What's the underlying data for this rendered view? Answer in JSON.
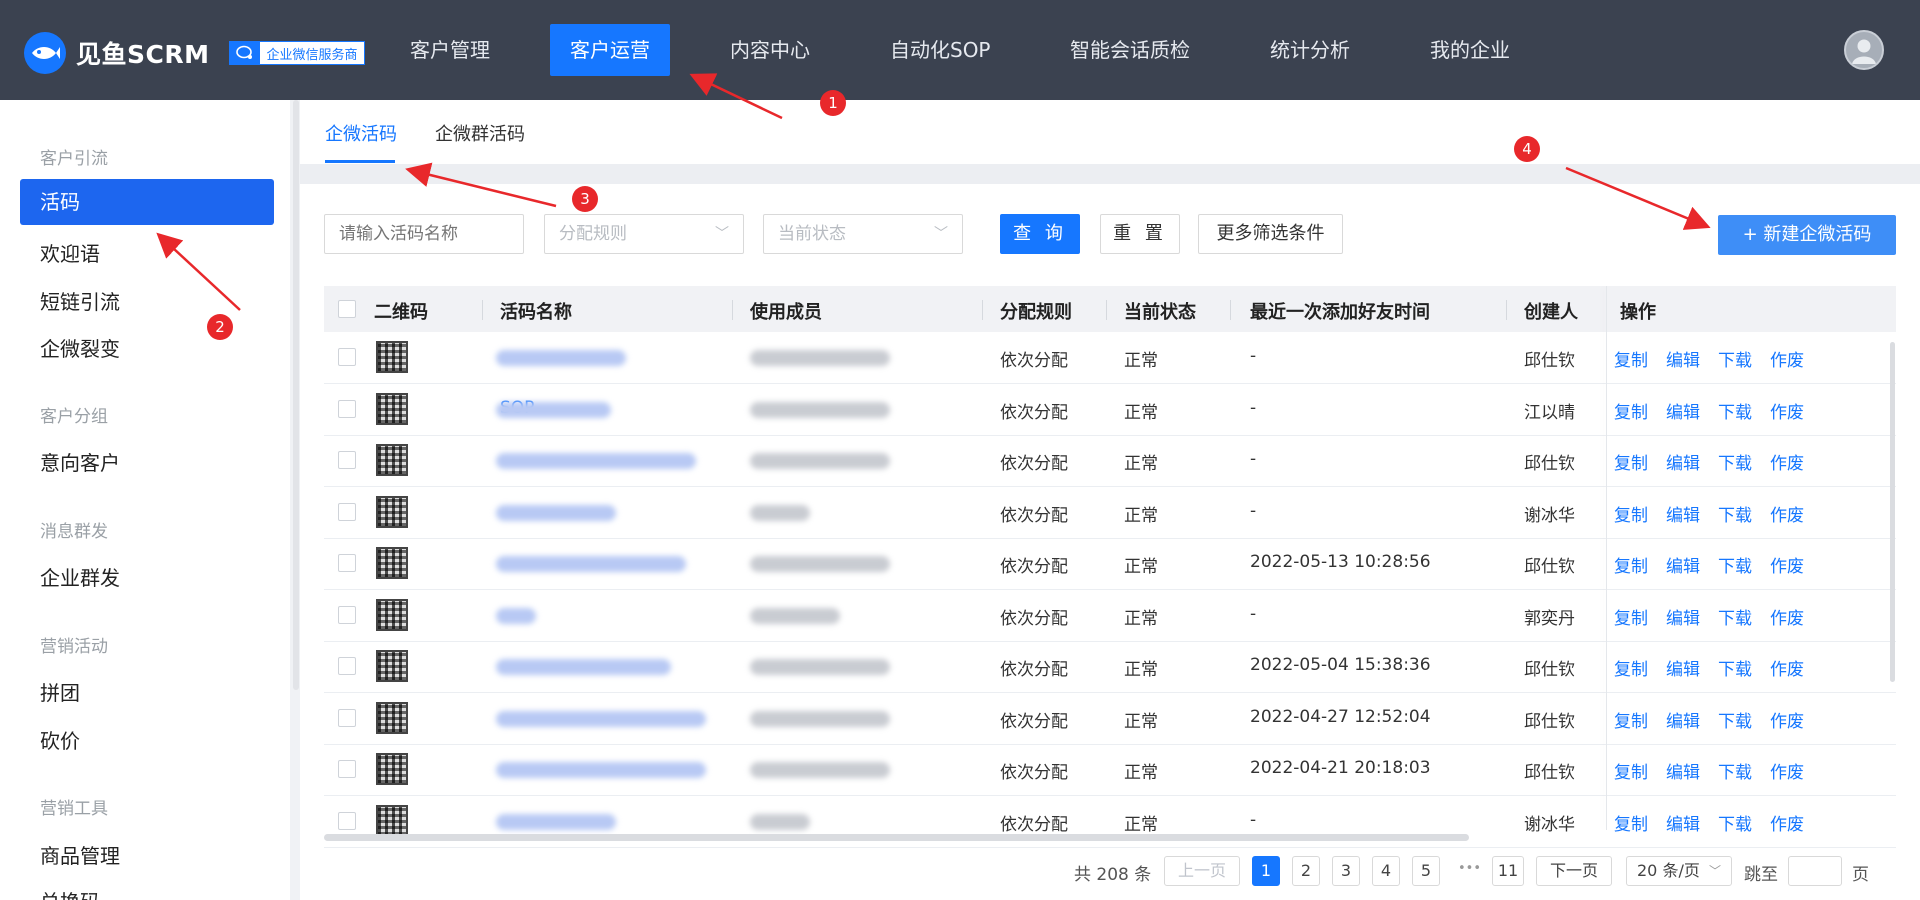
{
  "brand": {
    "name": "见鱼SCRM",
    "badge": "企业微信服务商"
  },
  "nav": [
    {
      "label": "客户管理"
    },
    {
      "label": "客户运营"
    },
    {
      "label": "内容中心"
    },
    {
      "label": "自动化SOP"
    },
    {
      "label": "智能会话质检"
    },
    {
      "label": "统计分析"
    },
    {
      "label": "我的企业"
    }
  ],
  "sidebar": {
    "groups": [
      "客户引流",
      "客户分组",
      "消息群发",
      "营销活动",
      "营销工具"
    ],
    "items": [
      "活码",
      "欢迎语",
      "短链引流",
      "企微裂变",
      "意向客户",
      "企业群发",
      "拼团",
      "砍价",
      "商品管理",
      "兑换码"
    ]
  },
  "tabs": [
    "企微活码",
    "企微群活码"
  ],
  "filters": {
    "name_placeholder": "请输入活码名称",
    "rule_placeholder": "分配规则",
    "status_placeholder": "当前状态",
    "query_label": "查 询",
    "reset_label": "重 置",
    "more_label": "更多筛选条件",
    "new_label": "+ 新建企微活码"
  },
  "table": {
    "headers": [
      "二维码",
      "活码名称",
      "使用成员",
      "分配规则",
      "当前状态",
      "最近一次添加好友时间",
      "创建人",
      "操作"
    ],
    "ops": [
      "复制",
      "编辑",
      "下载",
      "作废"
    ],
    "rows": [
      {
        "name": "",
        "rule": "依次分配",
        "status": "正常",
        "time": "-",
        "creator": "邱仕钦"
      },
      {
        "name": "SOP",
        "rule": "依次分配",
        "status": "正常",
        "time": "-",
        "creator": "江以晴"
      },
      {
        "name": "",
        "rule": "依次分配",
        "status": "正常",
        "time": "-",
        "creator": "邱仕钦"
      },
      {
        "name": "",
        "rule": "依次分配",
        "status": "正常",
        "time": "-",
        "creator": "谢冰华"
      },
      {
        "name": "",
        "rule": "依次分配",
        "status": "正常",
        "time": "2022-05-13 10:28:56",
        "creator": "邱仕钦"
      },
      {
        "name": "",
        "rule": "依次分配",
        "status": "正常",
        "time": "-",
        "creator": "郭奕丹"
      },
      {
        "name": "",
        "rule": "依次分配",
        "status": "正常",
        "time": "2022-05-04 15:38:36",
        "creator": "邱仕钦"
      },
      {
        "name": "",
        "rule": "依次分配",
        "status": "正常",
        "time": "2022-04-27 12:52:04",
        "creator": "邱仕钦"
      },
      {
        "name": "",
        "rule": "依次分配",
        "status": "正常",
        "time": "2022-04-21 20:18:03",
        "creator": "邱仕钦"
      },
      {
        "name": "",
        "rule": "依次分配",
        "status": "正常",
        "time": "-",
        "creator": "谢冰华"
      }
    ]
  },
  "pagination": {
    "total": "共 208 条",
    "prev": "上一页",
    "pages": [
      "1",
      "2",
      "3",
      "4",
      "5"
    ],
    "ellipsis": "•••",
    "last": "11",
    "next": "下一页",
    "size": "20 条/页",
    "jump": "跳至",
    "page_unit": "页"
  },
  "annotations": [
    "1",
    "2",
    "3",
    "4"
  ],
  "colors": {
    "primary": "#1677ff",
    "topbar": "#3b4250",
    "annotation": "#e8282b"
  }
}
